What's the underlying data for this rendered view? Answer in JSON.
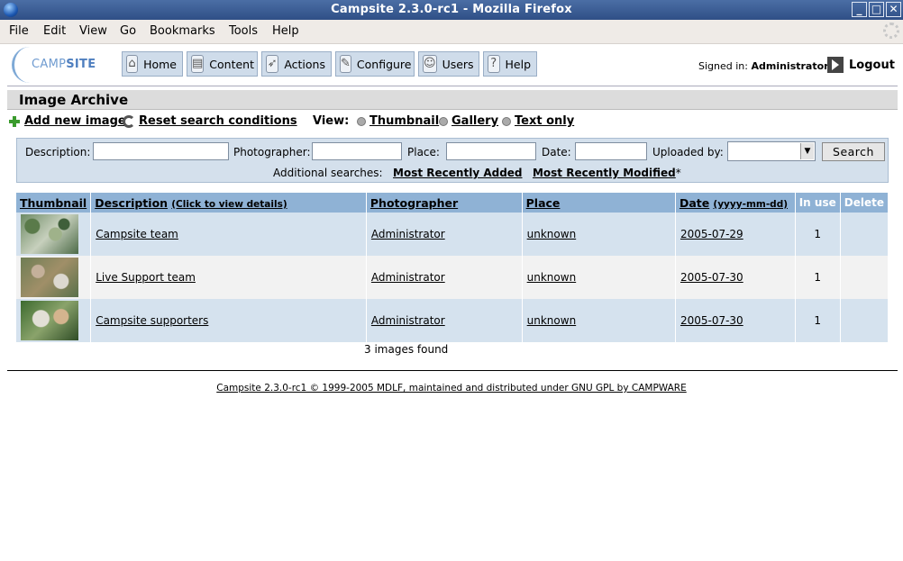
{
  "window": {
    "title": "Campsite 2.3.0-rc1 - Mozilla Firefox"
  },
  "menu": [
    "File",
    "Edit",
    "View",
    "Go",
    "Bookmarks",
    "Tools",
    "Help"
  ],
  "logo": {
    "prefix": "CAMP",
    "suffix": "SITE"
  },
  "nav": [
    "Home",
    "Content",
    "Actions",
    "Configure",
    "Users",
    "Help"
  ],
  "user": {
    "signed_label": "Signed in:",
    "name": "Administrator",
    "logout": "Logout"
  },
  "page": {
    "title": "Image Archive"
  },
  "actions": {
    "add": "Add new image",
    "reset": "Reset search conditions",
    "view_label": "View:",
    "views": [
      "Thumbnail",
      "Gallery",
      "Text only"
    ]
  },
  "search": {
    "description": "Description:",
    "photographer": "Photographer:",
    "place": "Place:",
    "date": "Date:",
    "uploaded_by": "Uploaded by:",
    "button": "Search",
    "additional": "Additional searches:",
    "recent_added": "Most Recently Added",
    "recent_modified": "Most Recently Modified",
    "asterisk": "*"
  },
  "table": {
    "headers": {
      "thumbnail": "Thumbnail",
      "description": "Description",
      "description_hint": "(Click to view details)",
      "photographer": "Photographer",
      "place": "Place",
      "date": "Date",
      "date_hint": "(yyyy-mm-dd)",
      "in_use": "In use",
      "delete": "Delete"
    },
    "rows": [
      {
        "description": "Campsite team",
        "photographer": "Administrator",
        "place": "unknown",
        "date": "2005-07-29",
        "in_use": "1"
      },
      {
        "description": "Live Support team",
        "photographer": "Administrator",
        "place": "unknown",
        "date": "2005-07-30",
        "in_use": "1"
      },
      {
        "description": "Campsite supporters",
        "photographer": "Administrator",
        "place": "unknown",
        "date": "2005-07-30",
        "in_use": "1"
      }
    ]
  },
  "found": "3 images found",
  "footer": "Campsite 2.3.0-rc1 © 1999-2005 MDLF, maintained and distributed under GNU GPL by CAMPWARE"
}
